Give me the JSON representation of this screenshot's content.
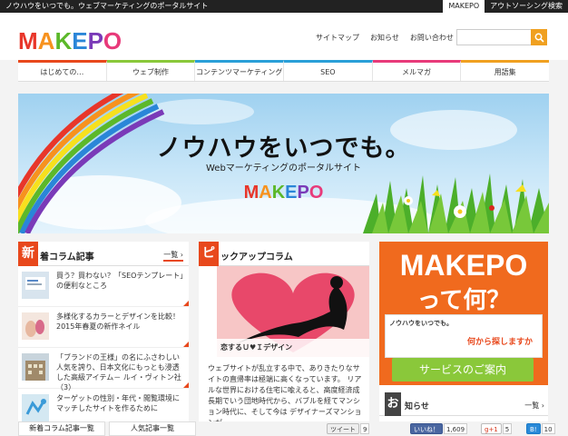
{
  "topbar": {
    "tagline": "ノウハウをいつでも。ウェブマーケティングのポータルサイト",
    "tabs": [
      "MAKEPO",
      "アウトソーシング検索"
    ]
  },
  "header": {
    "logo": "MAKEPO",
    "links": [
      "サイトマップ",
      "お知らせ",
      "お問い合わせ"
    ],
    "search_placeholder": ""
  },
  "nav": {
    "items": [
      {
        "label": "はじめての…",
        "color": "#e8481c"
      },
      {
        "label": "ウェブ制作",
        "color": "#8ac83a"
      },
      {
        "label": "コンテンツマーケティング",
        "color": "#2a9fd8"
      },
      {
        "label": "SEO",
        "color": "#2a9fd8"
      },
      {
        "label": "メルマガ",
        "color": "#e83a7a"
      },
      {
        "label": "用語集",
        "color": "#f0a020"
      }
    ]
  },
  "hero": {
    "title": "ノウハウをいつでも。",
    "subtitle": "Webマーケティングのポータルサイト",
    "logo": "MAKEPO"
  },
  "new_columns": {
    "badge": "新",
    "title": "着コラム記事",
    "more": "一覧 ›",
    "articles": [
      "買う？買わない？「SEOテンプレート」の便利なところ",
      "多様化するカラーとデザインを比較！2015年春夏の新作ネイル",
      "「ブランドの王様」の名にふさわしい人気を誇り、日本文化にもっとも浸透した高級アイテム－ ルイ・ヴィトン社（3）",
      "ターゲットの性別・年代・閲覧環境にマッチしたサイトを作るために"
    ]
  },
  "pickup": {
    "badge": "ピ",
    "title": "ックアップコラム",
    "label": "恋するＵ♥Ｉデザイン",
    "text": "ウェブサイトが乱立する中で、ありきたりなサイトの直帰率は極端に高くなっています。 リアルな世界における住宅に喩えると、高度経済成長期でいう団地時代から、バブルを経てマンション時代に、そして今は デザイナーズマンションが…"
  },
  "about": {
    "logo": "MAKEPO",
    "question": "って何？",
    "shot_title": "ノウハウをいつでも。",
    "shot_title2": "何から探しますか",
    "cta": "サービスのご案内"
  },
  "news": {
    "badge": "お",
    "title": "知らせ",
    "more": "一覧 ›"
  },
  "bottombar": {
    "tab1": "新着コラム記事一覧",
    "tab2": "人気記事一覧",
    "tweet": "ツイート",
    "tweet_count": "9",
    "like": "いいね！",
    "like_count": "1,609",
    "gplus": "g+1",
    "gplus_count": "5",
    "hatena": "B!",
    "hatena_count": "10"
  },
  "colors": {
    "accent": "#e8481c",
    "orange": "#f0a020",
    "green": "#8ac83a"
  }
}
